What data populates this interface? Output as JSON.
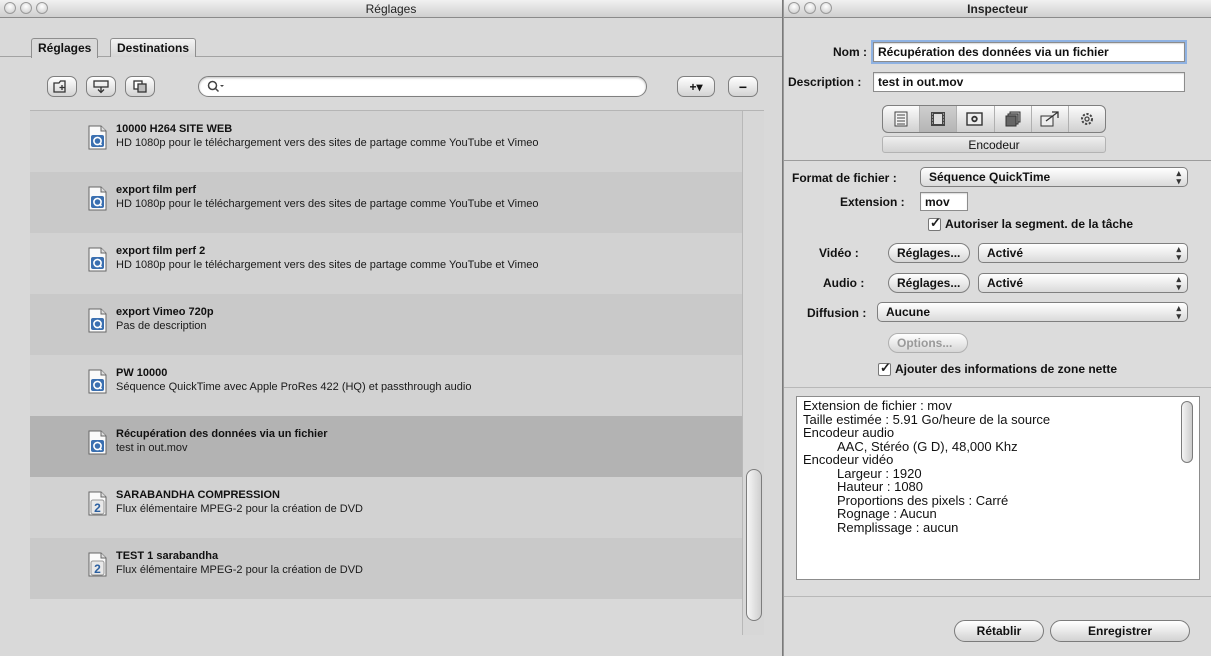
{
  "left_window": {
    "title": "Réglages",
    "tabs": [
      "Réglages",
      "Destinations"
    ],
    "search": {
      "value": "",
      "placeholder": ""
    },
    "toolbar_icons": [
      "new-folder-icon",
      "presets-icon",
      "duplicate-icon"
    ],
    "add_button_label": "+▾",
    "remove_button_label": "−",
    "settings": [
      {
        "name": "10000 H264 SITE WEB",
        "description": "HD 1080p pour le téléchargement vers des sites de partage comme YouTube et Vimeo",
        "icon": "quicktime-icon"
      },
      {
        "name": "export film perf",
        "description": "HD 1080p pour le téléchargement vers des sites de partage comme YouTube et Vimeo",
        "icon": "quicktime-icon"
      },
      {
        "name": "export film perf 2",
        "description": "HD 1080p pour le téléchargement vers des sites de partage comme YouTube et Vimeo",
        "icon": "quicktime-icon"
      },
      {
        "name": "export Vimeo 720p",
        "description": "Pas de description",
        "icon": "quicktime-icon"
      },
      {
        "name": "PW 10000",
        "description": "Séquence QuickTime avec Apple ProRes 422 (HQ) et passthrough audio",
        "icon": "quicktime-icon"
      },
      {
        "name": "Récupération des données via un fichier",
        "description": "test in out.mov",
        "icon": "quicktime-icon",
        "selected": true
      },
      {
        "name": "SARABANDHA COMPRESSION",
        "description": "Flux élémentaire MPEG-2 pour la création de DVD",
        "icon": "mpeg2-icon"
      },
      {
        "name": "TEST 1 sarabandha",
        "description": "Flux élémentaire MPEG-2 pour la création de DVD",
        "icon": "mpeg2-icon"
      }
    ]
  },
  "inspector": {
    "title": "Inspecteur",
    "name_label": "Nom :",
    "name_value": "Récupération des données via un fichier",
    "description_label": "Description :",
    "description_value": "test in out.mov",
    "pane_tabs": [
      "summary-icon",
      "encoder-icon",
      "frame-controls-icon",
      "filters-icon",
      "geometry-icon",
      "actions-icon"
    ],
    "active_pane": "Encodeur",
    "format_label": "Format de fichier :",
    "format_value": "Séquence QuickTime",
    "extension_label": "Extension :",
    "extension_value": "mov",
    "segment_checkbox": "Autoriser la segment. de la tâche",
    "video_label": "Vidéo :",
    "video_settings_button": "Réglages...",
    "video_state": "Activé",
    "audio_label": "Audio :",
    "audio_settings_button": "Réglages...",
    "audio_state": "Activé",
    "streaming_label": "Diffusion :",
    "streaming_value": "Aucune",
    "options_button": "Options...",
    "clean_aperture_checkbox": "Ajouter des informations de zone nette",
    "summary_lines": [
      {
        "text": "Extension de fichier : mov",
        "indent": false
      },
      {
        "text": "Taille estimée : 5.91 Go/heure de la source",
        "indent": false
      },
      {
        "text": "Encodeur audio",
        "indent": false
      },
      {
        "text": "AAC, Stéréo (G D), 48,000 Khz",
        "indent": true
      },
      {
        "text": "Encodeur vidéo",
        "indent": false
      },
      {
        "text": "Largeur : 1920",
        "indent": true
      },
      {
        "text": "Hauteur : 1080",
        "indent": true
      },
      {
        "text": "Proportions des pixels : Carré",
        "indent": true
      },
      {
        "text": "Rognage : Aucun",
        "indent": true
      },
      {
        "text": "Remplissage : aucun",
        "indent": true
      }
    ],
    "revert_button": "Rétablir",
    "save_button": "Enregistrer"
  }
}
